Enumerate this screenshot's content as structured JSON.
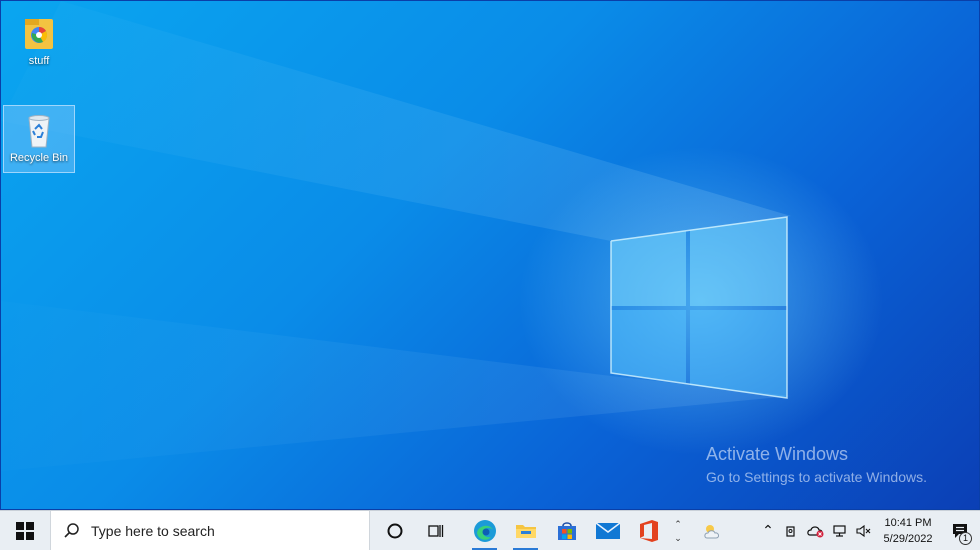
{
  "desktop": {
    "icons": [
      {
        "label": "stuff"
      },
      {
        "label": "Recycle Bin"
      }
    ],
    "watermark": {
      "title": "Activate Windows",
      "subtitle": "Go to Settings to activate Windows."
    }
  },
  "taskbar": {
    "search_placeholder": "Type here to search",
    "pinned_apps": [
      "cortana-icon",
      "task-view-icon",
      "edge-icon",
      "file-explorer-icon",
      "store-icon",
      "mail-icon",
      "office-icon"
    ],
    "clock": {
      "time": "10:41 PM",
      "date": "5/29/2022"
    },
    "notification_count": "1"
  }
}
